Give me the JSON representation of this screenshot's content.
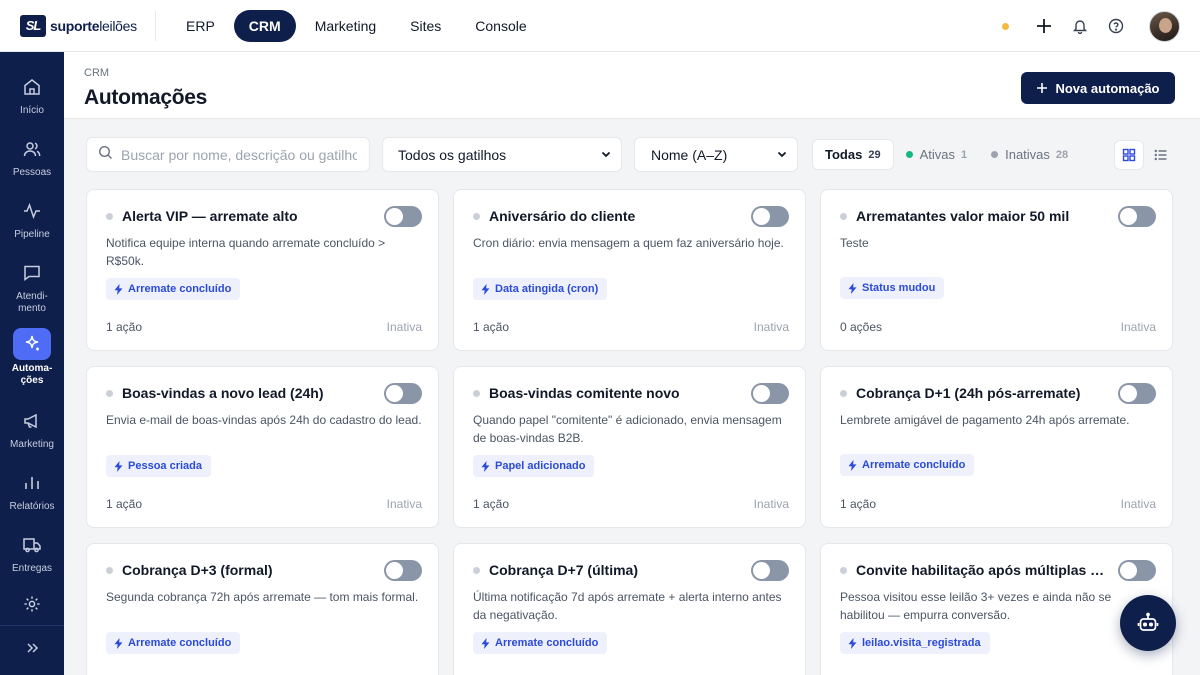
{
  "logo": {
    "mark": "SL",
    "bold": "suporte",
    "light": "leilões"
  },
  "topnav": [
    "ERP",
    "CRM",
    "Marketing",
    "Sites",
    "Console"
  ],
  "sidebar": [
    {
      "label": "Início",
      "icon": "home-icon"
    },
    {
      "label": "Pessoas",
      "icon": "users-icon"
    },
    {
      "label": "Pipeline",
      "icon": "activity-icon"
    },
    {
      "label": "Atendi-\nmento",
      "icon": "chat-icon"
    },
    {
      "label": "Automa-\nções",
      "icon": "sparkle-icon"
    },
    {
      "label": "Marketing",
      "icon": "megaphone-icon"
    },
    {
      "label": "Relatórios",
      "icon": "bar-chart-icon"
    },
    {
      "label": "Entregas",
      "icon": "truck-icon"
    },
    {
      "label": "",
      "icon": "gear-icon"
    }
  ],
  "header": {
    "breadcrumb": "CRM",
    "title": "Automações",
    "new_button": "Nova automação"
  },
  "filters": {
    "search_placeholder": "Buscar por nome, descrição ou gatilho",
    "trigger_select": "Todos os gatilhos",
    "sort_select": "Nome (A–Z)",
    "chips": [
      {
        "label": "Todas",
        "count": "29",
        "color": ""
      },
      {
        "label": "Ativas",
        "count": "1",
        "color": "#10b981"
      },
      {
        "label": "Inativas",
        "count": "28",
        "color": "#9ca3af"
      }
    ]
  },
  "cards": [
    {
      "title": "Alerta VIP — arremate alto",
      "desc": "Notifica equipe interna quando arremate concluído > R$50k.",
      "tag": "Arremate concluído",
      "actions": "1 ação",
      "status": "Inativa"
    },
    {
      "title": "Aniversário do cliente",
      "desc": "Cron diário: envia mensagem a quem faz aniversário hoje.",
      "tag": "Data atingida (cron)",
      "actions": "1 ação",
      "status": "Inativa"
    },
    {
      "title": "Arrematantes valor maior 50 mil",
      "desc": "Teste",
      "tag": "Status mudou",
      "actions": "0 ações",
      "status": "Inativa"
    },
    {
      "title": "Boas-vindas a novo lead (24h)",
      "desc": "Envia e-mail de boas-vindas após 24h do cadastro do lead.",
      "tag": "Pessoa criada",
      "actions": "1 ação",
      "status": "Inativa"
    },
    {
      "title": "Boas-vindas comitente novo",
      "desc": "Quando papel \"comitente\" é adicionado, envia mensagem de boas-vindas B2B.",
      "tag": "Papel adicionado",
      "actions": "1 ação",
      "status": "Inativa"
    },
    {
      "title": "Cobrança D+1 (24h pós-arremate)",
      "desc": "Lembrete amigável de pagamento 24h após arremate.",
      "tag": "Arremate concluído",
      "actions": "1 ação",
      "status": "Inativa"
    },
    {
      "title": "Cobrança D+3 (formal)",
      "desc": "Segunda cobrança 72h após arremate — tom mais formal.",
      "tag": "Arremate concluído",
      "actions": "",
      "status": ""
    },
    {
      "title": "Cobrança D+7 (última)",
      "desc": "Última notificação 7d após arremate + alerta interno antes da negativação.",
      "tag": "Arremate concluído",
      "actions": "",
      "status": ""
    },
    {
      "title": "Convite habilitação após múltiplas visitas",
      "desc": "Pessoa visitou esse leilão 3+ vezes e ainda não se habilitou — empurra conversão.",
      "tag": "leilao.visita_registrada",
      "actions": "",
      "status": ""
    }
  ]
}
